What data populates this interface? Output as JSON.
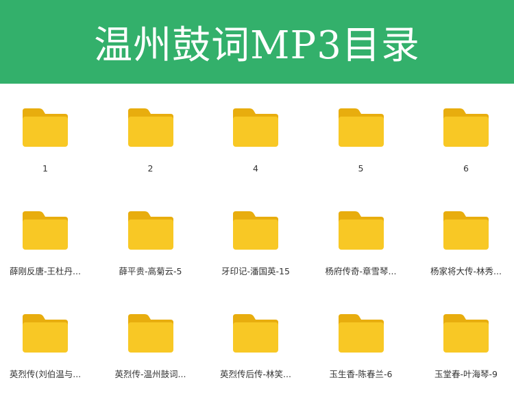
{
  "header": {
    "title": "温州鼓词MP3目录",
    "background_color": "#33b06b",
    "text_color": "#ffffff"
  },
  "folder_colors": {
    "tab": "#e8ad0e",
    "body": "#f8c825"
  },
  "folders": [
    {
      "label": "1",
      "icon": "folder-icon"
    },
    {
      "label": "2",
      "icon": "folder-icon"
    },
    {
      "label": "4",
      "icon": "folder-icon"
    },
    {
      "label": "5",
      "icon": "folder-icon"
    },
    {
      "label": "6",
      "icon": "folder-icon"
    },
    {
      "label": "薛刚反唐-王杜丹...",
      "icon": "folder-icon"
    },
    {
      "label": "薛平贵-高菊云-5",
      "icon": "folder-icon"
    },
    {
      "label": "牙印记-潘国英-15",
      "icon": "folder-icon"
    },
    {
      "label": "杨府传奇-章雪琴...",
      "icon": "folder-icon"
    },
    {
      "label": "杨家将大传-林秀...",
      "icon": "folder-icon"
    },
    {
      "label": "英烈传(刘伯温与...",
      "icon": "folder-icon"
    },
    {
      "label": "英烈传-温州鼓词...",
      "icon": "folder-icon"
    },
    {
      "label": "英烈传后传-林笑...",
      "icon": "folder-icon"
    },
    {
      "label": "玉生香-陈春兰-6",
      "icon": "folder-icon"
    },
    {
      "label": "玉堂春-叶海琴-9",
      "icon": "folder-icon"
    }
  ]
}
